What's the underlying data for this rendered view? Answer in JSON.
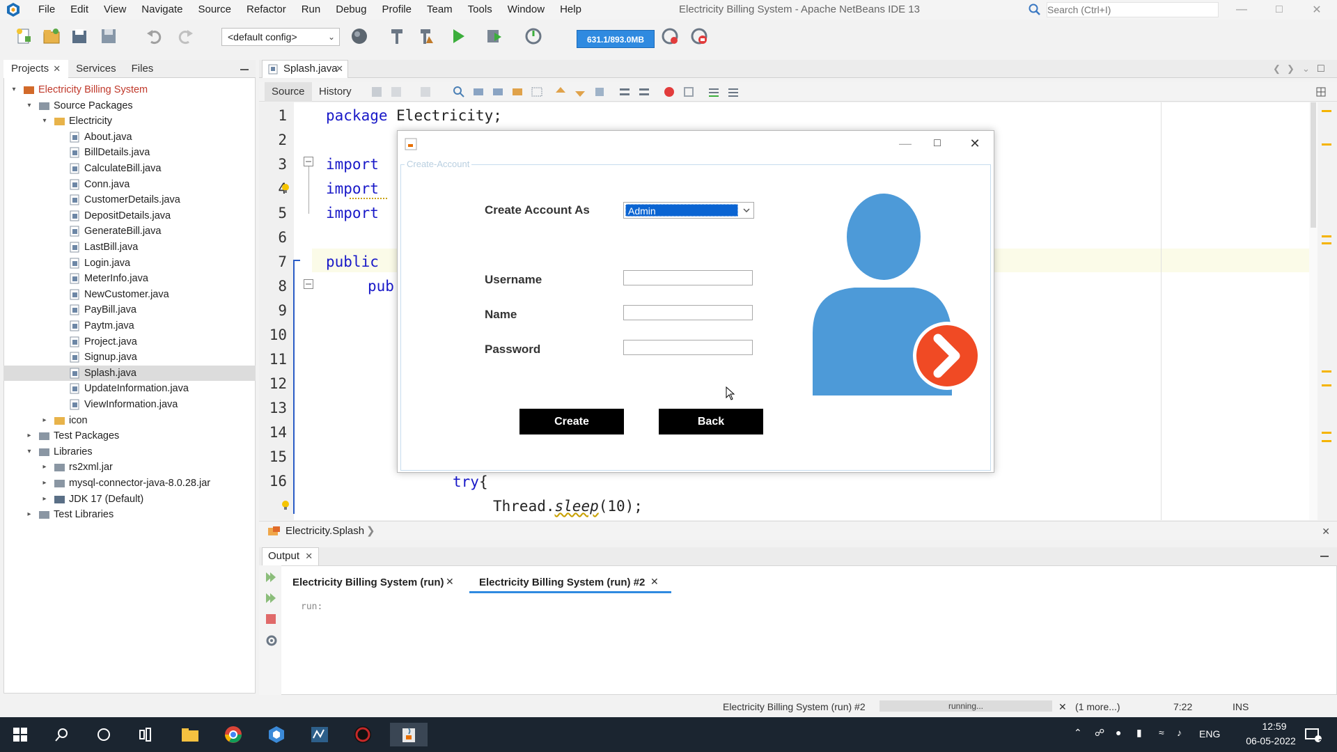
{
  "window": {
    "title": "Electricity Billing System - Apache NetBeans IDE 13",
    "search_placeholder": "Search (Ctrl+I)"
  },
  "menu": [
    "File",
    "Edit",
    "View",
    "Navigate",
    "Source",
    "Refactor",
    "Run",
    "Debug",
    "Profile",
    "Team",
    "Tools",
    "Window",
    "Help"
  ],
  "toolbar": {
    "config": "<default config>",
    "memory": "631.1/893.0MB"
  },
  "left_panel": {
    "tabs": [
      "Projects",
      "Services",
      "Files"
    ],
    "tree": [
      {
        "label": "Electricity Billing System",
        "type": "project"
      },
      {
        "label": "Source Packages",
        "type": "folder"
      },
      {
        "label": "Electricity",
        "type": "package"
      },
      {
        "label": "About.java",
        "type": "java"
      },
      {
        "label": "BillDetails.java",
        "type": "java"
      },
      {
        "label": "CalculateBill.java",
        "type": "java"
      },
      {
        "label": "Conn.java",
        "type": "java"
      },
      {
        "label": "CustomerDetails.java",
        "type": "java"
      },
      {
        "label": "DepositDetails.java",
        "type": "java"
      },
      {
        "label": "GenerateBill.java",
        "type": "java"
      },
      {
        "label": "LastBill.java",
        "type": "java"
      },
      {
        "label": "Login.java",
        "type": "java"
      },
      {
        "label": "MeterInfo.java",
        "type": "java"
      },
      {
        "label": "NewCustomer.java",
        "type": "java"
      },
      {
        "label": "PayBill.java",
        "type": "java"
      },
      {
        "label": "Paytm.java",
        "type": "java"
      },
      {
        "label": "Project.java",
        "type": "java"
      },
      {
        "label": "Signup.java",
        "type": "java"
      },
      {
        "label": "Splash.java",
        "type": "java",
        "selected": true
      },
      {
        "label": "UpdateInformation.java",
        "type": "java"
      },
      {
        "label": "ViewInformation.java",
        "type": "java"
      },
      {
        "label": "icon",
        "type": "package"
      },
      {
        "label": "Test Packages",
        "type": "folder"
      },
      {
        "label": "Libraries",
        "type": "folder"
      },
      {
        "label": "rs2xml.jar",
        "type": "jar"
      },
      {
        "label": "mysql-connector-java-8.0.28.jar",
        "type": "jar"
      },
      {
        "label": "JDK 17 (Default)",
        "type": "jdk"
      },
      {
        "label": "Test Libraries",
        "type": "folder"
      }
    ]
  },
  "editor": {
    "tab": "Splash.java",
    "source_tab": "Source",
    "history_tab": "History",
    "line_numbers": [
      "1",
      "2",
      "3",
      "4",
      "5",
      "6",
      "7",
      "8",
      "9",
      "10",
      "11",
      "12",
      "13",
      "14",
      "15",
      "16"
    ],
    "code": {
      "l1_kw": "package",
      "l1_rest": " Electricity;",
      "l3": "import",
      "l4": "import",
      "l5": "import",
      "l7": "public",
      "l8": "pub",
      "l16_kw": "try",
      "l16_rest": "{",
      "l17_a": "Thread.",
      "l17_b": "sleep",
      "l17_c": "(10);"
    },
    "breadcrumb": "Electricity.Splash"
  },
  "output": {
    "title": "Output",
    "tabs": [
      "Electricity Billing System (run)",
      "Electricity Billing System (run) #2"
    ],
    "text": "run:"
  },
  "statusbar": {
    "task": "Electricity Billing System (run) #2",
    "progress": "running...",
    "more": "(1 more...)",
    "position": "7:22",
    "mode": "INS"
  },
  "taskbar": {
    "language": "ENG",
    "time": "12:59",
    "date": "06-05-2022",
    "notifications": "3"
  },
  "dialog": {
    "legend": "Create-Account",
    "create_as_label": "Create Account As",
    "create_as_value": "Admin",
    "username_label": "Username",
    "name_label": "Name",
    "password_label": "Password",
    "create_button": "Create",
    "back_button": "Back",
    "colors": {
      "avatar": "#4d9ad8",
      "arrow": "#f04a24"
    }
  }
}
